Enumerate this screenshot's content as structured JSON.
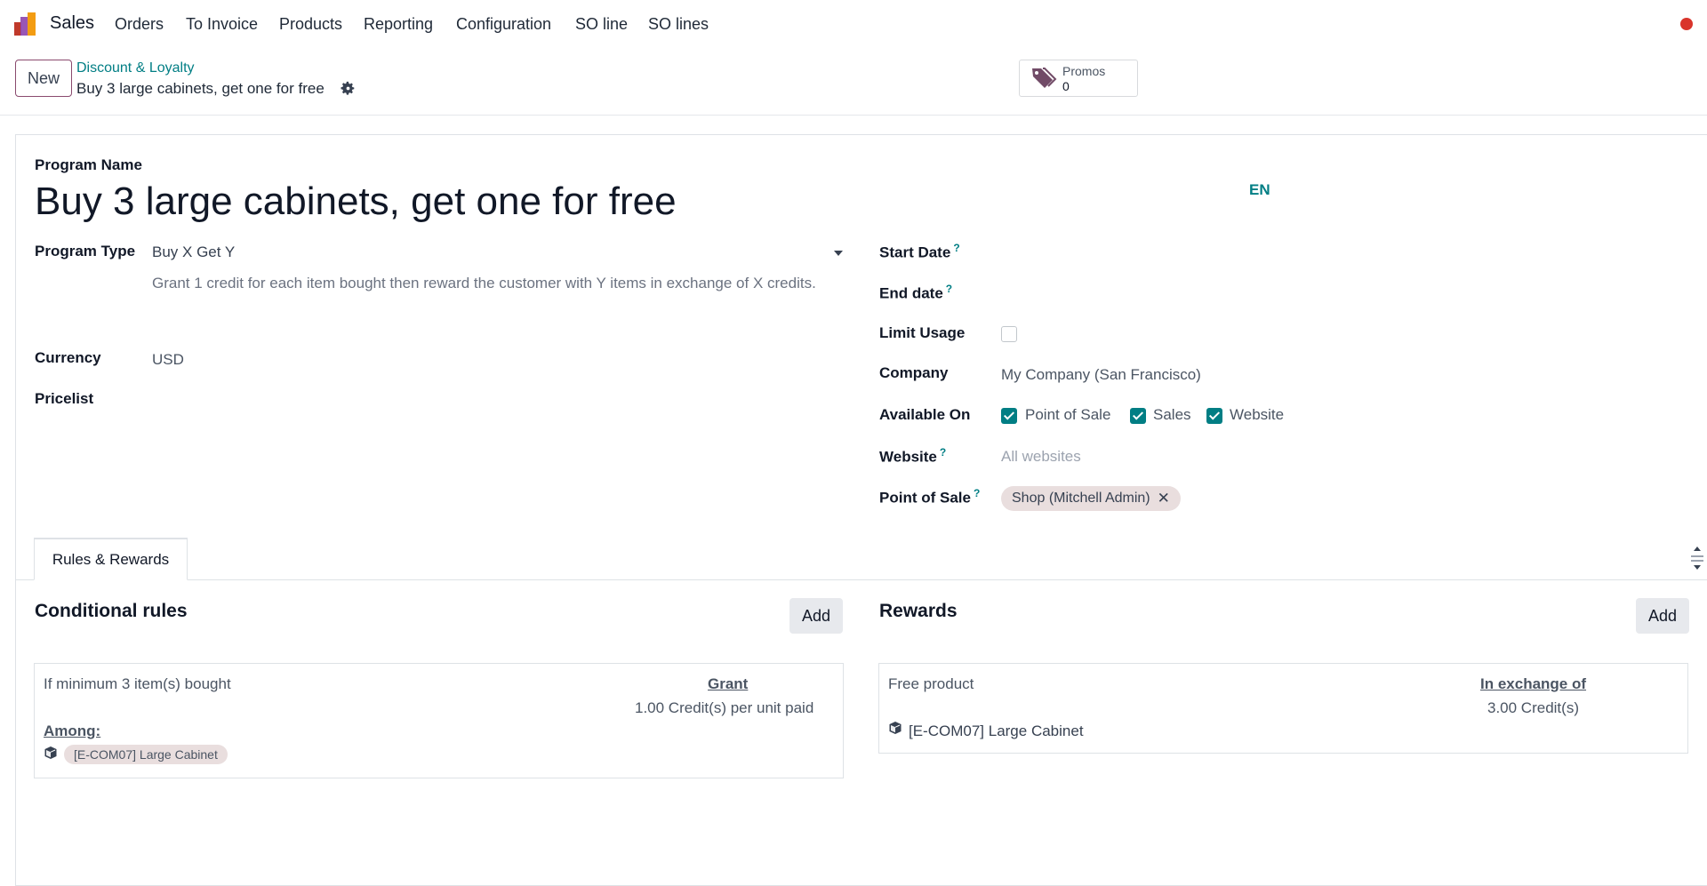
{
  "navbar": {
    "app_name": "Sales",
    "menu": [
      "Orders",
      "To Invoice",
      "Products",
      "Reporting",
      "Configuration",
      "SO line",
      "SO lines"
    ]
  },
  "control_panel": {
    "new_label": "New",
    "breadcrumb_parent": "Discount & Loyalty",
    "breadcrumb_current": "Buy 3 large cabinets, get one for free",
    "promos_label": "Promos",
    "promos_count": "0"
  },
  "form": {
    "program_name_label": "Program Name",
    "program_name": "Buy 3 large cabinets, get one for free",
    "lang": "EN",
    "program_type_label": "Program Type",
    "program_type_value": "Buy X Get Y",
    "program_type_desc": "Grant 1 credit for each item bought then reward the customer with Y items in exchange of X credits.",
    "currency_label": "Currency",
    "currency_value": "USD",
    "pricelist_label": "Pricelist",
    "start_date_label": "Start Date",
    "end_date_label": "End date",
    "limit_usage_label": "Limit Usage",
    "company_label": "Company",
    "company_value": "My Company (San Francisco)",
    "available_on_label": "Available On",
    "available_on": [
      {
        "label": "Point of Sale",
        "checked": true
      },
      {
        "label": "Sales",
        "checked": true
      },
      {
        "label": "Website",
        "checked": true
      }
    ],
    "website_label": "Website",
    "website_placeholder": "All websites",
    "pos_label": "Point of Sale",
    "pos_tag": "Shop (Mitchell Admin)",
    "help_mark": "?"
  },
  "tabs": {
    "rules_rewards": "Rules & Rewards"
  },
  "rules": {
    "title": "Conditional rules",
    "add_label": "Add",
    "condition": "If minimum 3 item(s) bought",
    "grant_header": "Grant",
    "grant_value": "1.00 Credit(s) per unit paid",
    "among_label": "Among:",
    "product": "[E-COM07] Large Cabinet"
  },
  "rewards": {
    "title": "Rewards",
    "add_label": "Add",
    "reward_type": "Free product",
    "exchange_header": "In exchange of",
    "exchange_value": "3.00 Credit(s)",
    "product": "[E-COM07] Large Cabinet"
  },
  "colors": {
    "accent": "#017e84",
    "brand": "#714B67",
    "status_dot": "#d9342b",
    "tag_bg": "#e9dede"
  }
}
